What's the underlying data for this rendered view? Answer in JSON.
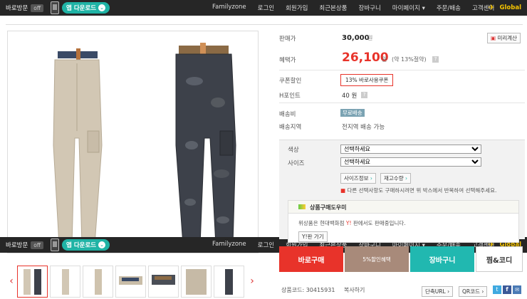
{
  "topbar": {
    "visit_label": "바로방문",
    "off_label": "off",
    "app_label": "앱 다운로드",
    "nav": [
      "Familyzone",
      "로그인",
      "회원가입",
      "최근본상품",
      "장바구니",
      "마이페이지 ▾",
      "주문/배송",
      "고객센터"
    ],
    "global_label": "Global"
  },
  "product": {
    "price_label": "판매가",
    "price_value": "30,000",
    "price_unit": "원",
    "calc_button": "미리계산",
    "benefit_label": "혜택가",
    "benefit_value": "26,100",
    "benefit_unit": "원",
    "benefit_note": "(약 13%절약)",
    "coupon_label": "쿠폰할인",
    "coupon_value": "13% 바로사용쿠폰",
    "points_label": "H포인트",
    "points_value": "40 원",
    "shipping_label": "배송비",
    "shipping_value": "무료배송",
    "shipping_area_label": "배송지역",
    "shipping_area_value": "전지역 배송 가능"
  },
  "options": {
    "color_label": "색상",
    "color_value": "선택하세요",
    "size_label": "사이즈",
    "size_value": "선택하세요",
    "size_info_button": "사이즈정보",
    "stock_button": "재고수량",
    "notice": "다른 선택사항도 구매하시려면 위 박스에서 반복하여 선택해주세요."
  },
  "helper": {
    "title": "상품구매도우미",
    "text_prefix": "위상품은 현대백화점",
    "text_tag": "Y!",
    "text_suffix": "판에서도 판매중입니다.",
    "link": "Y!판 가기"
  },
  "buttons": {
    "buy_now": "바로구매",
    "buy2_sub": "5%할인혜택",
    "cart": "장바구니",
    "wish": "찜&코디"
  },
  "footer": {
    "code_label": "상품코드:",
    "code_value": "30415931",
    "copy_label": "복사하기",
    "short_url": "단축URL",
    "qr_code": "QR코드"
  },
  "colors": {
    "accent_red": "#e8332a",
    "teal": "#21b8b0",
    "benefit_red": "#e8332a"
  }
}
